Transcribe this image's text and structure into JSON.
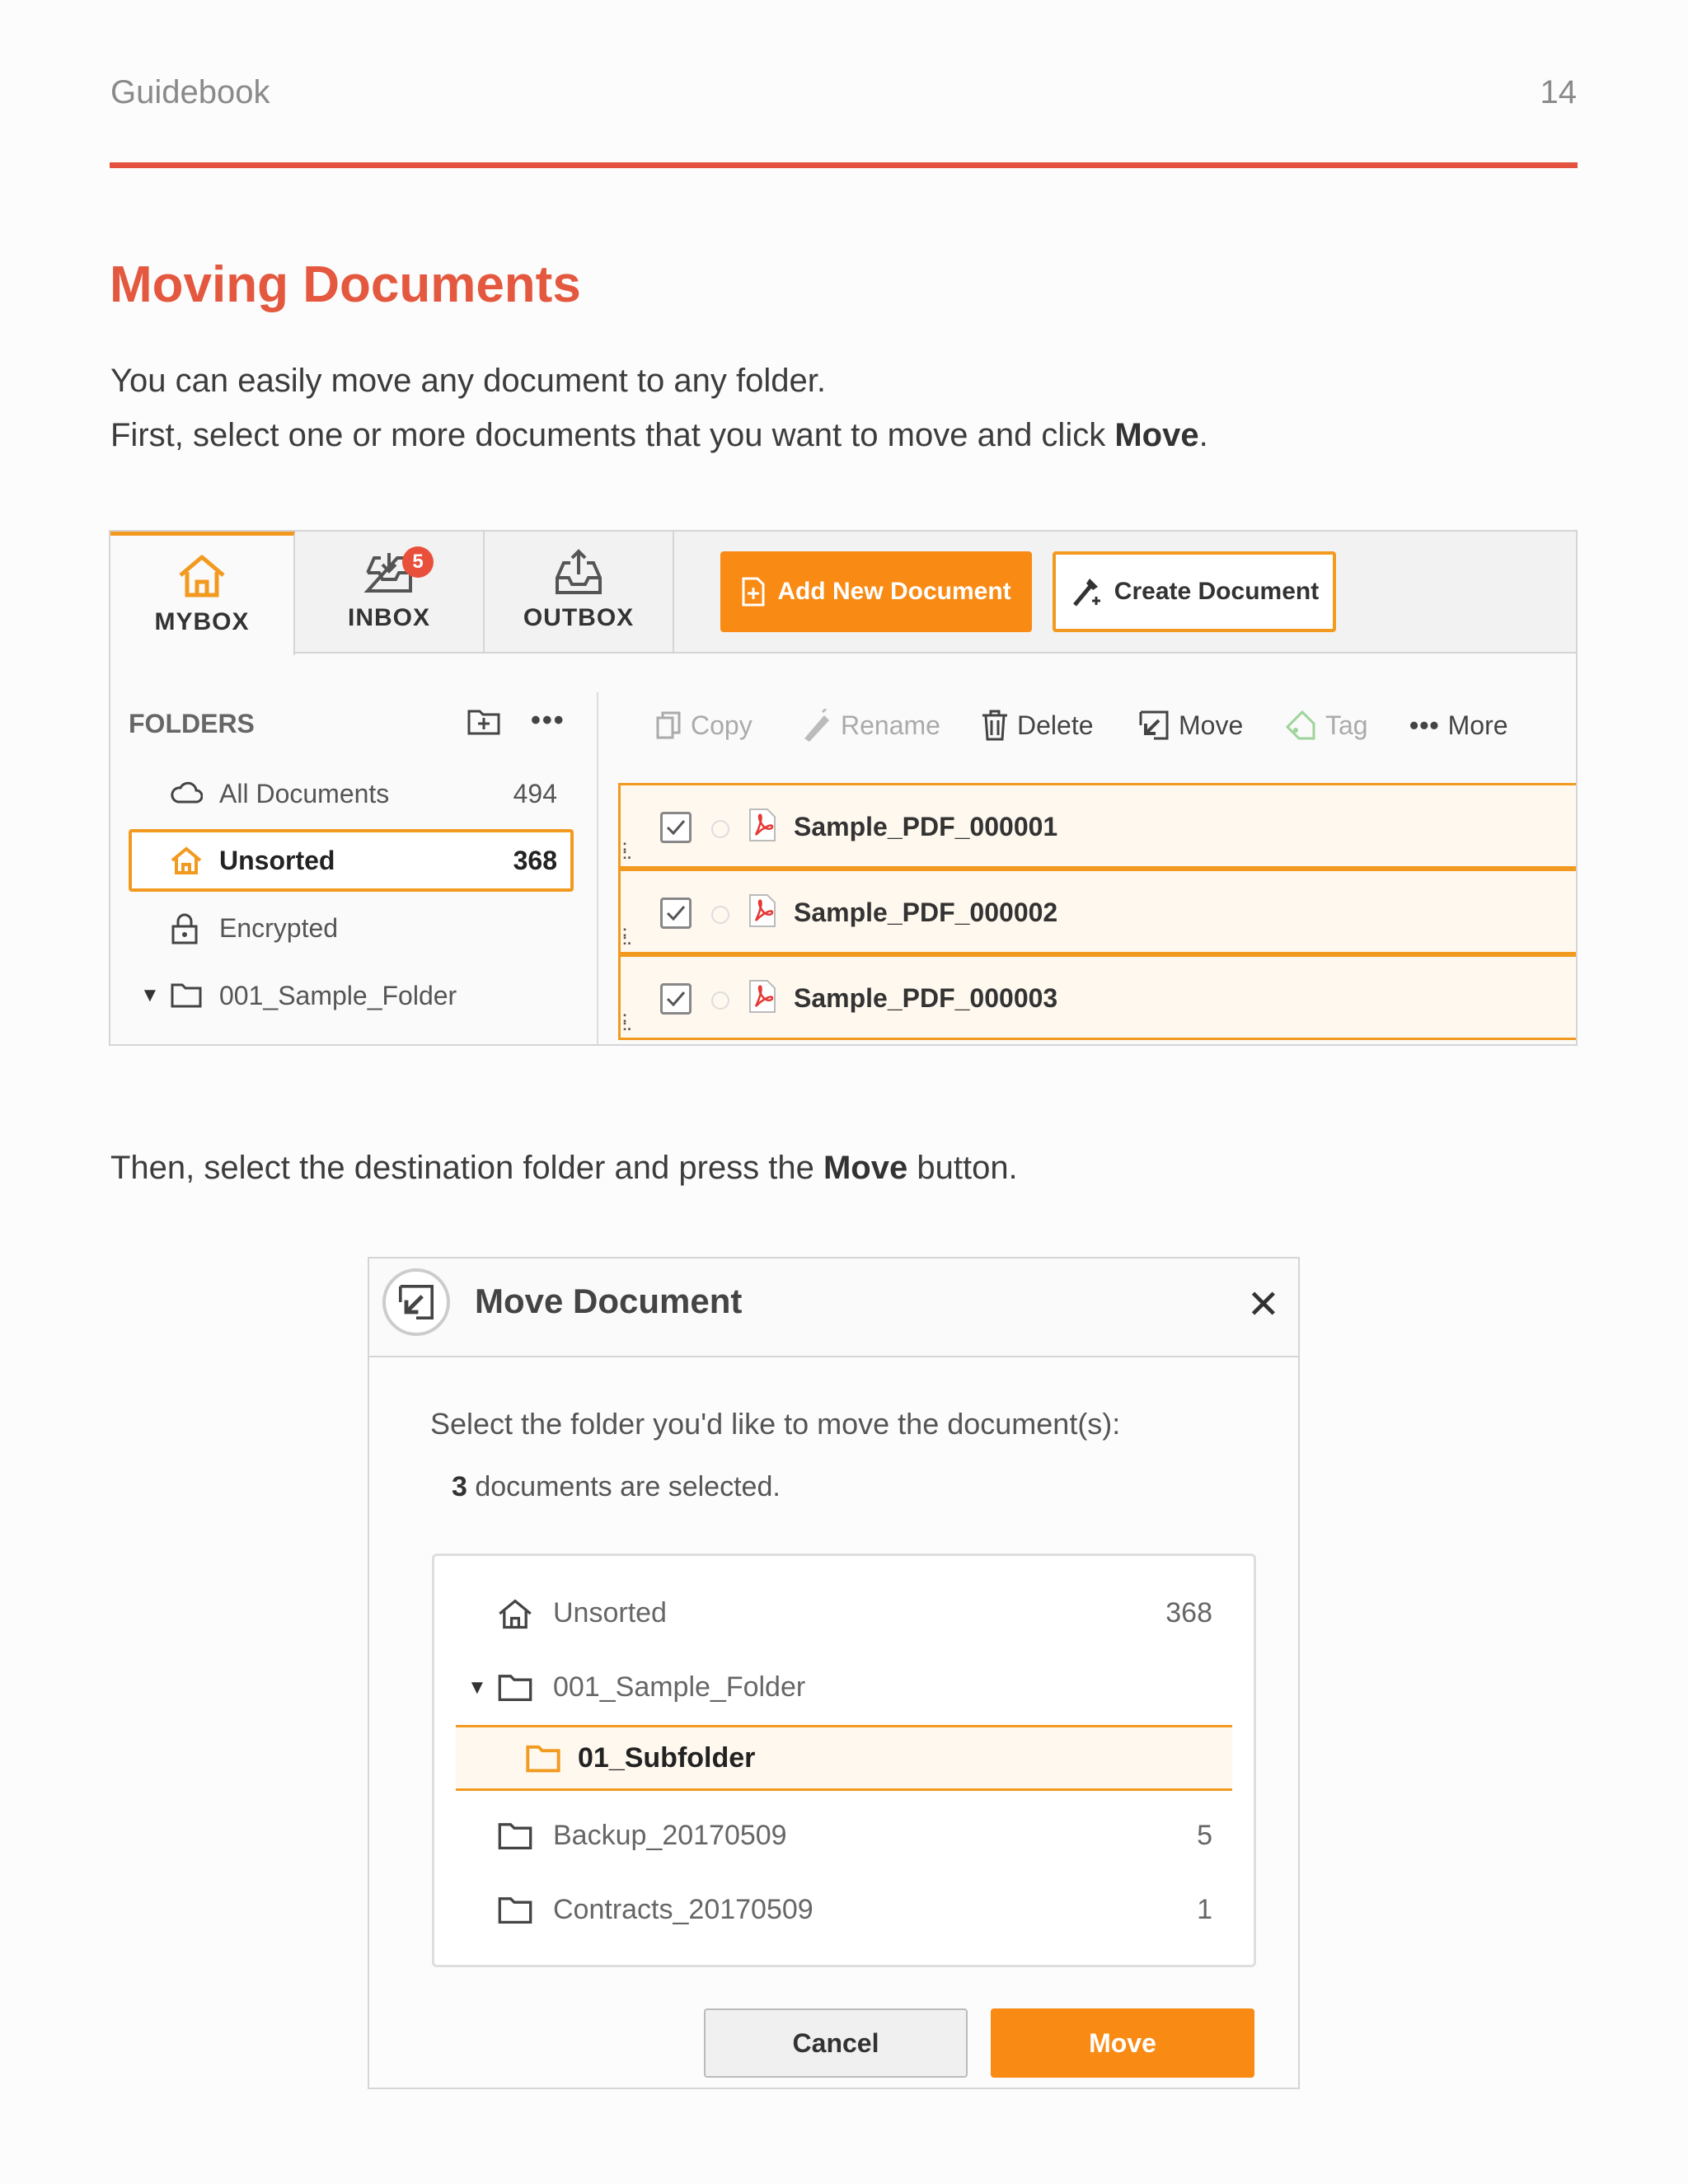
{
  "header": {
    "label": "Guidebook",
    "page_number": "14"
  },
  "section": {
    "title": "Moving Documents",
    "para1": "You can easily move any document to any folder.",
    "para2_pre": "First, select one or more documents that you want to move and click ",
    "para2_bold": "Move",
    "para2_post": ".",
    "para3_pre": "Then, select the destination folder and press the ",
    "para3_bold": "Move",
    "para3_post": " button."
  },
  "app": {
    "tabs": [
      {
        "label": "MYBOX",
        "icon": "house-icon"
      },
      {
        "label": "INBOX",
        "icon": "inbox-icon",
        "badge": "5"
      },
      {
        "label": "OUTBOX",
        "icon": "outbox-icon"
      }
    ],
    "add_new_document": "Add New Document",
    "create_document": "Create Document",
    "folders_heading": "FOLDERS",
    "folders": [
      {
        "label": "All Documents",
        "count": "494",
        "icon": "cloud-icon"
      },
      {
        "label": "Unsorted",
        "count": "368",
        "icon": "house-icon"
      },
      {
        "label": "Encrypted",
        "count": "",
        "icon": "lock-icon"
      },
      {
        "label": "001_Sample_Folder",
        "count": "",
        "icon": "folder-icon"
      }
    ],
    "toolbar": {
      "copy": "Copy",
      "rename": "Rename",
      "delete": "Delete",
      "move": "Move",
      "tag": "Tag",
      "more": "More"
    },
    "documents": [
      {
        "name": "Sample_PDF_000001"
      },
      {
        "name": "Sample_PDF_000002"
      },
      {
        "name": "Sample_PDF_000003"
      }
    ],
    "accent": "#f98a14"
  },
  "dialog": {
    "title": "Move Document",
    "close": "✕",
    "instruction": "Select the folder you'd like to move the document(s):",
    "selected_count": "3",
    "selected_text": " documents are selected.",
    "folders": [
      {
        "label": "Unsorted",
        "count": "368"
      },
      {
        "label": "001_Sample_Folder",
        "count": ""
      },
      {
        "label": "01_Subfolder",
        "count": ""
      },
      {
        "label": "Backup_20170509",
        "count": "5"
      },
      {
        "label": "Contracts_20170509",
        "count": "1"
      }
    ],
    "cancel_label": "Cancel",
    "move_label": "Move"
  }
}
